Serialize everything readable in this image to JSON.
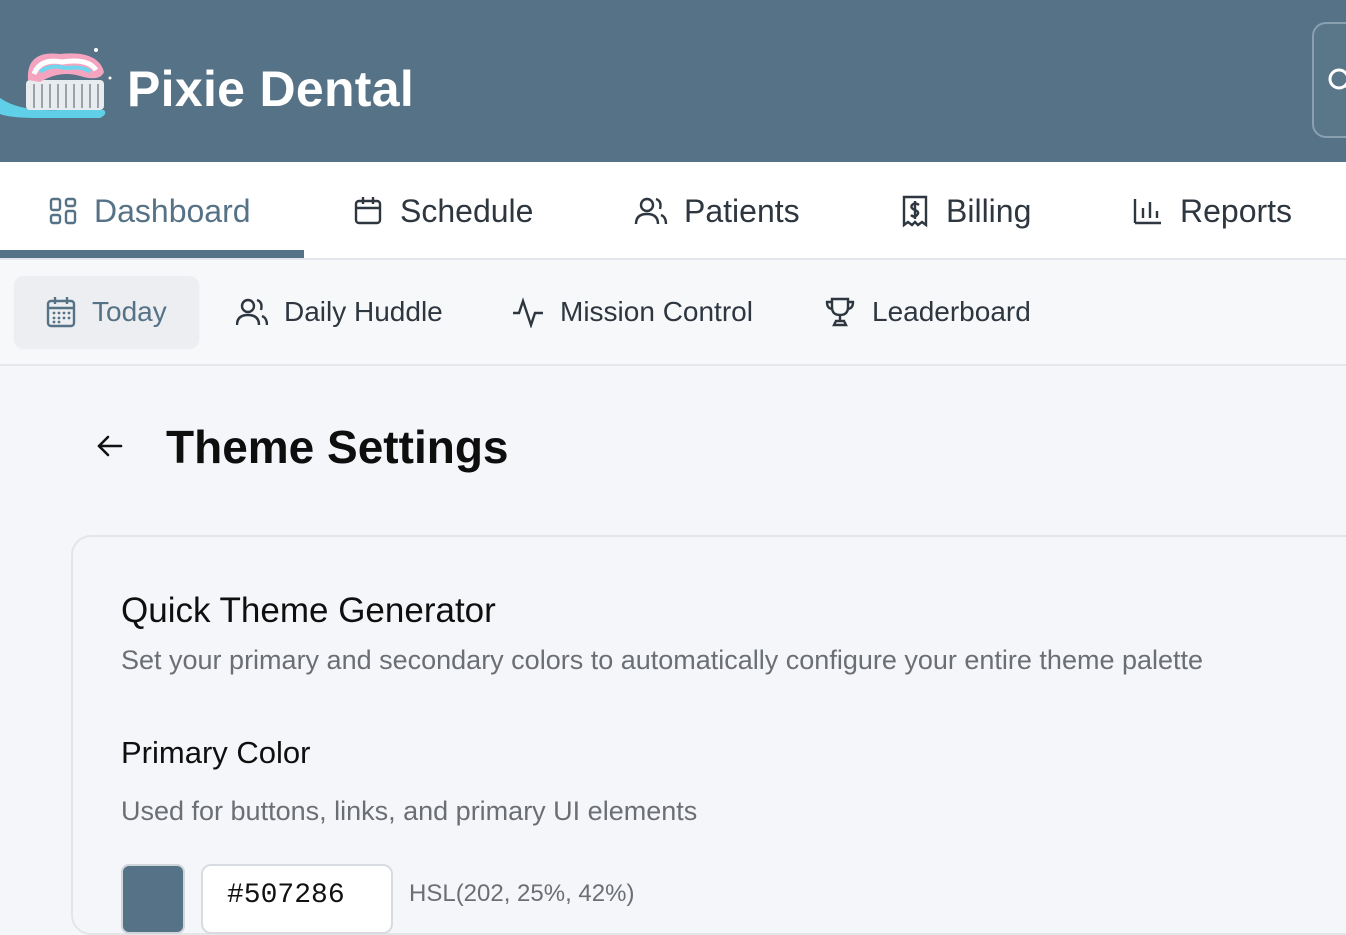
{
  "header": {
    "brand": "Pixie Dental",
    "colors": {
      "header_bg": "#567286",
      "brand_text": "#ffffff"
    }
  },
  "main_tabs": [
    {
      "label": "Dashboard",
      "icon": "dashboard-grid-icon",
      "active": true
    },
    {
      "label": "Schedule",
      "icon": "calendar-icon",
      "active": false
    },
    {
      "label": "Patients",
      "icon": "users-icon",
      "active": false
    },
    {
      "label": "Billing",
      "icon": "receipt-dollar-icon",
      "active": false
    },
    {
      "label": "Reports",
      "icon": "bar-chart-icon",
      "active": false
    }
  ],
  "sub_tabs": [
    {
      "label": "Today",
      "icon": "calendar-icon",
      "active": true
    },
    {
      "label": "Daily Huddle",
      "icon": "users-icon",
      "active": false
    },
    {
      "label": "Mission Control",
      "icon": "activity-icon",
      "active": false
    },
    {
      "label": "Leaderboard",
      "icon": "trophy-icon",
      "active": false
    }
  ],
  "page": {
    "title": "Theme Settings",
    "back_icon": "arrow-left-icon"
  },
  "card": {
    "title": "Quick Theme Generator",
    "subtitle": "Set your primary and secondary colors to automatically configure your entire theme palette",
    "primary": {
      "title": "Primary Color",
      "description": "Used for buttons, links, and primary UI elements",
      "hex_value": "#507286",
      "swatch_color": "#567286",
      "hsl": "HSL(202, 25%, 42%)"
    }
  }
}
